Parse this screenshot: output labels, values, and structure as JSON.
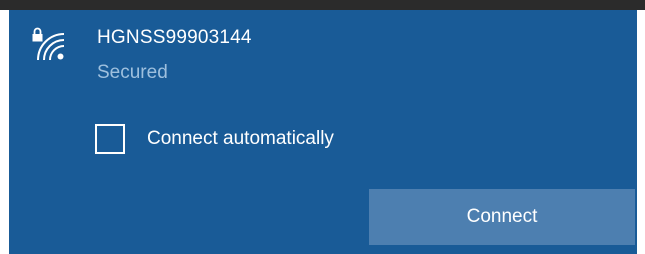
{
  "network": {
    "name": "HGNSS99903144",
    "status": "Secured",
    "icon": "wifi-secured-icon"
  },
  "auto_connect": {
    "label": "Connect automatically",
    "checked": false
  },
  "actions": {
    "connect_label": "Connect"
  },
  "colors": {
    "panel_background": "#195b97",
    "button_background": "#4d7fb0",
    "secondary_text": "#9ec0de",
    "primary_text": "#ffffff"
  }
}
